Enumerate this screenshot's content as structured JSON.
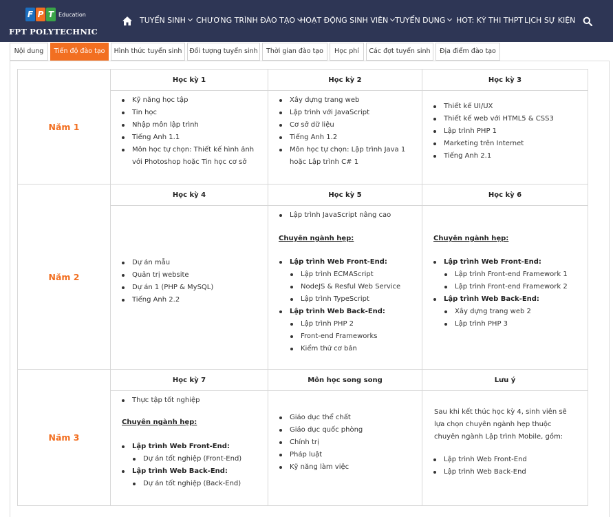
{
  "nav": {
    "logo_mark_colors": [
      "#1c6fbf",
      "#f26f21",
      "#3aa548"
    ],
    "logo_mark_letters": "FPT",
    "logo_edu": "Education",
    "logo_name": "FPT POLYTECHNIC",
    "home_icon": "home-icon",
    "items": [
      {
        "label": "TUYỂN SINH",
        "dropdown": true
      },
      {
        "label": "CHƯƠNG TRÌNH ĐÀO TẠO",
        "dropdown": true
      },
      {
        "label": "HOẠT ĐỘNG SINH VIÊN",
        "dropdown": true
      },
      {
        "label": "TUYỂN DỤNG",
        "dropdown": true
      },
      {
        "label": "HOT: KỲ THI THPT",
        "dropdown": false
      },
      {
        "label": "LỊCH SỰ KIỆN",
        "dropdown": false
      }
    ],
    "search_icon": "search-icon",
    "background": "#2e3655"
  },
  "tabs": [
    {
      "label": "Nội dung",
      "active": false
    },
    {
      "label": "Tiến độ đào tạo",
      "active": true
    },
    {
      "label": "Hình thức tuyển sinh",
      "active": false
    },
    {
      "label": "Đối tượng tuyển sinh",
      "active": false
    },
    {
      "label": "Thời gian đào tạo",
      "active": false
    },
    {
      "label": "Học phí",
      "active": false
    },
    {
      "label": "Các đợt tuyển sinh",
      "active": false
    },
    {
      "label": "Địa điểm đào tạo",
      "active": false
    }
  ],
  "accent": "#f26f21",
  "years": [
    {
      "label": "Năm 1",
      "semesters": [
        {
          "title": "Học kỳ 1",
          "items": [
            {
              "text": "Kỹ năng học tập"
            },
            {
              "text": "Tin học"
            },
            {
              "text": "Nhập môn lập trình"
            },
            {
              "text": "Tiếng Anh 1.1"
            },
            {
              "text": "Môn học tự chọn: Thiết kế hình ảnh với Photoshop hoặc Tin học cơ sở"
            }
          ]
        },
        {
          "title": "Học kỳ 2",
          "items": [
            {
              "text": "Xây dựng trang web"
            },
            {
              "text": "Lập trình với JavaScript"
            },
            {
              "text": "Cơ sở dữ liệu"
            },
            {
              "text": "Tiếng Anh 1.2"
            },
            {
              "text": "Môn học tự chọn: Lập trình Java 1 hoặc Lập trình C# 1"
            }
          ]
        },
        {
          "title": "Học kỳ 3",
          "items": [
            {
              "text": "Thiết kế UI/UX"
            },
            {
              "text": "Thiết kế web với HTML5 & CSS3"
            },
            {
              "text": "Lập trình PHP 1"
            },
            {
              "text": "Marketing trên Internet"
            },
            {
              "text": "Tiếng Anh 2.1"
            }
          ]
        }
      ]
    },
    {
      "label": "Năm 2",
      "semesters": [
        {
          "title": "Học kỳ 4",
          "items": [
            {
              "text": "Dự án mẫu"
            },
            {
              "text": "Quản trị website"
            },
            {
              "text": "Dự án 1 (PHP & MySQL)"
            },
            {
              "text": "Tiếng Anh 2.2"
            }
          ]
        },
        {
          "title": "Học kỳ 5",
          "top_items": [
            {
              "text": "Lập trình JavaScript nâng cao"
            }
          ],
          "spec_label": "Chuyên ngành hẹp:",
          "items": [
            {
              "text": "Lập trình Web Front-End:",
              "bold": true
            },
            {
              "text": "Lập trình ECMAScript",
              "sub": true
            },
            {
              "text": "NodeJS & Resful Web Service",
              "sub": true
            },
            {
              "text": "Lập trình TypeScript",
              "sub": true
            },
            {
              "text": "Lập trình Web Back-End:",
              "bold": true
            },
            {
              "text": "Lập trình PHP 2",
              "sub": true
            },
            {
              "text": "Front-end Frameworks",
              "sub": true
            },
            {
              "text": "Kiểm thử cơ bản",
              "sub": true
            }
          ]
        },
        {
          "title": "Học kỳ 6",
          "spec_label": "Chuyên ngành hẹp:",
          "items": [
            {
              "text": "Lập trình Web Front-End:",
              "bold": true
            },
            {
              "text": "Lập trình Front-end Framework 1",
              "sub": true
            },
            {
              "text": "Lập trình Front-end Framework 2",
              "sub": true
            },
            {
              "text": "Lập trình Web Back-End:",
              "bold": true
            },
            {
              "text": "Xây dựng trang web 2",
              "sub": true
            },
            {
              "text": "Lập trình PHP 3",
              "sub": true
            }
          ]
        }
      ]
    },
    {
      "label": "Năm 3",
      "semesters": [
        {
          "title": "Học kỳ 7",
          "top_items": [
            {
              "text": "Thực tập tốt nghiệp"
            }
          ],
          "spec_label": "Chuyên ngành hẹp:",
          "items": [
            {
              "text": "Lập trình Web Front-End:",
              "bold": true
            },
            {
              "text": "Dự án tốt nghiệp (Front-End)",
              "sub": true
            },
            {
              "text": "Lập trình Web Back-End:",
              "bold": true
            },
            {
              "text": "Dự án tốt nghiệp (Back-End)",
              "sub": true
            }
          ]
        },
        {
          "title": "Môn học song song",
          "items": [
            {
              "text": "Giáo dục thể chất"
            },
            {
              "text": "Giáo dục quốc phòng"
            },
            {
              "text": "Chính trị"
            },
            {
              "text": "Pháp luật"
            },
            {
              "text": "Kỹ năng làm việc"
            }
          ]
        },
        {
          "title": "Lưu ý",
          "note": "Sau khi kết thúc học kỳ 4, sinh viên sẽ lựa chọn chuyên ngành hẹp thuộc chuyên ngành Lập trình Mobile, gồm:",
          "items": [
            {
              "text": "Lập trình Web Front-End"
            },
            {
              "text": "Lập trình Web Back-End"
            }
          ]
        }
      ]
    }
  ]
}
